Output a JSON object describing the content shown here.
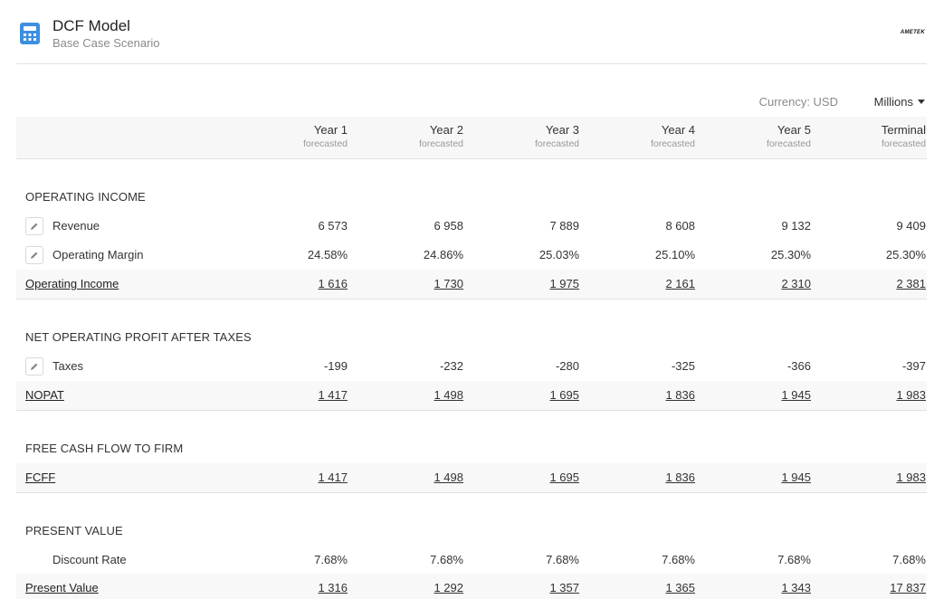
{
  "header": {
    "title": "DCF Model",
    "subtitle": "Base Case Scenario",
    "logo_text": "AMETEK"
  },
  "units": {
    "currency": "Currency: USD",
    "scale": "Millions"
  },
  "columns": [
    {
      "year": "Year 1",
      "note": "forecasted"
    },
    {
      "year": "Year 2",
      "note": "forecasted"
    },
    {
      "year": "Year 3",
      "note": "forecasted"
    },
    {
      "year": "Year 4",
      "note": "forecasted"
    },
    {
      "year": "Year 5",
      "note": "forecasted"
    },
    {
      "year": "Terminal",
      "note": "forecasted"
    }
  ],
  "sections": {
    "operating_income": {
      "title": "OPERATING INCOME",
      "revenue": {
        "label": "Revenue",
        "values": [
          "6 573",
          "6 958",
          "7 889",
          "8 608",
          "9 132",
          "9 409"
        ]
      },
      "operating_margin": {
        "label": "Operating Margin",
        "values": [
          "24.58%",
          "24.86%",
          "25.03%",
          "25.10%",
          "25.30%",
          "25.30%"
        ]
      },
      "total": {
        "label": "Operating Income",
        "values": [
          "1 616",
          "1 730",
          "1 975",
          "2 161",
          "2 310",
          "2 381"
        ]
      }
    },
    "nopat": {
      "title": "NET OPERATING PROFIT AFTER TAXES",
      "taxes": {
        "label": "Taxes",
        "values": [
          "-199",
          "-232",
          "-280",
          "-325",
          "-366",
          "-397"
        ]
      },
      "total": {
        "label": "NOPAT",
        "values": [
          "1 417",
          "1 498",
          "1 695",
          "1 836",
          "1 945",
          "1 983"
        ]
      }
    },
    "fcff": {
      "title": "FREE CASH FLOW TO FIRM",
      "total": {
        "label": "FCFF",
        "values": [
          "1 417",
          "1 498",
          "1 695",
          "1 836",
          "1 945",
          "1 983"
        ]
      }
    },
    "present_value": {
      "title": "PRESENT VALUE",
      "discount_rate": {
        "label": "Discount Rate",
        "values": [
          "7.68%",
          "7.68%",
          "7.68%",
          "7.68%",
          "7.68%",
          "7.68%"
        ]
      },
      "total": {
        "label": "Present Value",
        "values": [
          "1 316",
          "1 292",
          "1 357",
          "1 365",
          "1 343",
          "17 837"
        ]
      }
    }
  },
  "icons": {
    "app": "calculator-icon",
    "edit": "pencil-icon",
    "dropdown": "caret-down-icon"
  },
  "colors": {
    "accent": "#3d8fe0",
    "total_row_bg": "#f8f8f8",
    "header_bg": "#f7f7f7",
    "muted_text": "#8a8a8a"
  }
}
